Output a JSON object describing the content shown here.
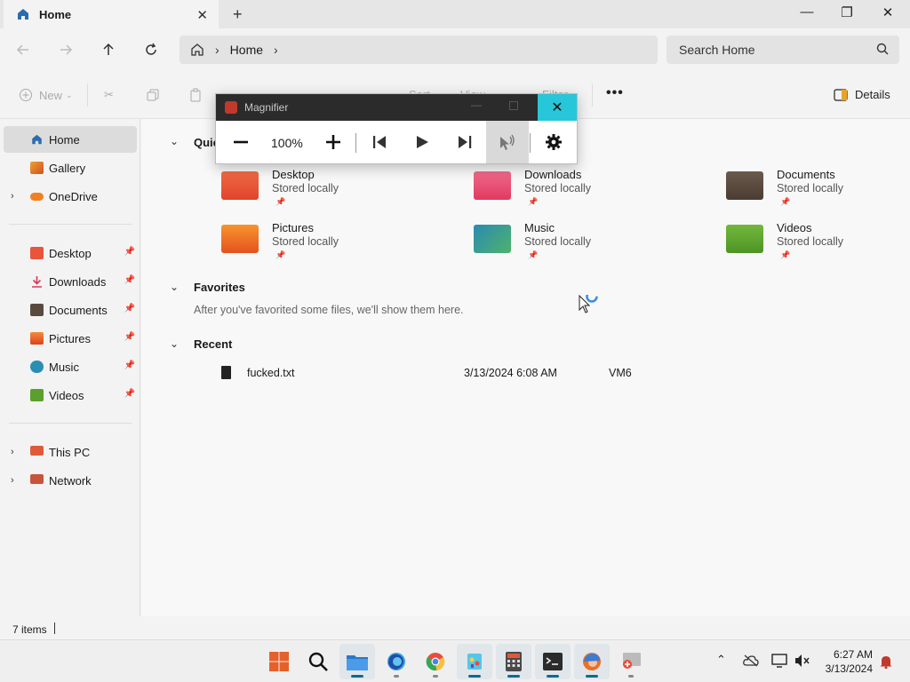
{
  "tab": {
    "title": "Home",
    "close": "✕",
    "new": "+"
  },
  "window_controls": {
    "minimize": "—",
    "maximize": "❐",
    "close": "✕"
  },
  "nav": {
    "breadcrumb": [
      "Home"
    ],
    "search_placeholder": "Search Home"
  },
  "command_bar": {
    "new_label": "New",
    "sort_label": "Sort",
    "view_label": "View",
    "filter_label": "Filter",
    "more_label": "•••",
    "details_label": "Details"
  },
  "sidebar": {
    "top": [
      {
        "label": "Home",
        "icon": "home-icon",
        "selected": true
      },
      {
        "label": "Gallery",
        "icon": "gallery-icon"
      },
      {
        "label": "OneDrive",
        "icon": "onedrive-icon",
        "expandable": true
      }
    ],
    "pinned": [
      {
        "label": "Desktop",
        "icon": "desktop-icon",
        "color": "#e8553b"
      },
      {
        "label": "Downloads",
        "icon": "downloads-icon",
        "color": "#d63a5a"
      },
      {
        "label": "Documents",
        "icon": "documents-icon",
        "color": "#5a4a3e"
      },
      {
        "label": "Pictures",
        "icon": "pictures-icon",
        "color": "#ef6a2a"
      },
      {
        "label": "Music",
        "icon": "music-icon",
        "color": "#2b8fb5"
      },
      {
        "label": "Videos",
        "icon": "videos-icon",
        "color": "#5aa02c"
      }
    ],
    "bottom": [
      {
        "label": "This PC",
        "icon": "this-pc-icon"
      },
      {
        "label": "Network",
        "icon": "network-icon"
      }
    ]
  },
  "main": {
    "quick_access": {
      "title": "Quick access",
      "items": [
        {
          "name": "Desktop",
          "sub": "Stored locally",
          "color": "#ec5a36"
        },
        {
          "name": "Downloads",
          "sub": "Stored locally",
          "color": "#e8456b"
        },
        {
          "name": "Documents",
          "sub": "Stored locally",
          "color": "#5b4a3f"
        },
        {
          "name": "Pictures",
          "sub": "Stored locally",
          "color": "#f07a2a"
        },
        {
          "name": "Music",
          "sub": "Stored locally",
          "color": "#2a8ab3"
        },
        {
          "name": "Videos",
          "sub": "Stored locally",
          "color": "#5ea531"
        }
      ]
    },
    "favorites": {
      "title": "Favorites",
      "note": "After you've favorited some files, we'll show them here."
    },
    "recent": {
      "title": "Recent",
      "items": [
        {
          "name": "fucked.txt",
          "date": "3/13/2024 6:08 AM",
          "location": "VM6"
        }
      ]
    }
  },
  "magnifier": {
    "title": "Magnifier",
    "zoom": "100%",
    "close": "✕"
  },
  "status": {
    "item_count": "7 items"
  },
  "taskbar": {
    "apps": [
      "start-icon",
      "search-icon",
      "file-explorer-icon",
      "firefox-icon",
      "chrome-icon",
      "paint-icon",
      "calculator-icon",
      "terminal-icon",
      "edge-icon",
      "magnifier-icon"
    ],
    "clock_time": "6:27 AM",
    "clock_date": "3/13/2024"
  }
}
